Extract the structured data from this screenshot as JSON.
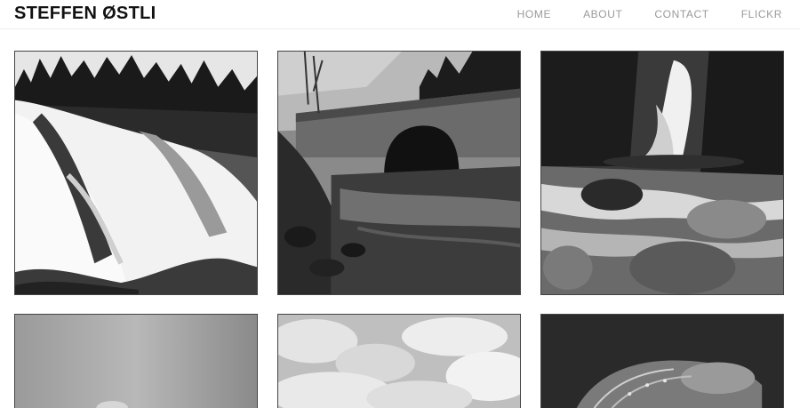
{
  "site": {
    "title": "STEFFEN ØSTLI"
  },
  "nav": {
    "items": [
      {
        "label": "HOME"
      },
      {
        "label": "ABOUT"
      },
      {
        "label": "CONTACT"
      },
      {
        "label": "FLICKR"
      }
    ]
  },
  "gallery": {
    "photos": [
      {
        "subject": "waterfall-over-rocks"
      },
      {
        "subject": "stone-arch-bridge-over-river"
      },
      {
        "subject": "waterfall-with-boulders"
      },
      {
        "subject": "blurred-figure"
      },
      {
        "subject": "cloudy-sky"
      },
      {
        "subject": "dandelion-seed-head"
      }
    ]
  }
}
